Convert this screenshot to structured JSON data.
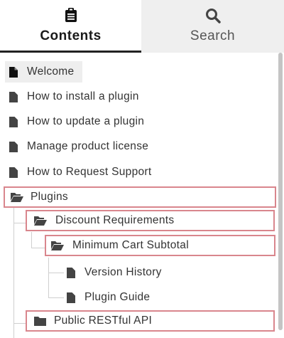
{
  "tabs": {
    "contents": {
      "label": "Contents",
      "icon": "clipboard-icon"
    },
    "search": {
      "label": "Search",
      "icon": "search-icon"
    }
  },
  "tree": {
    "welcome": "Welcome",
    "install": "How to install a plugin",
    "update": "How to update a plugin",
    "license": "Manage product license",
    "support": "How to Request Support",
    "plugins": "Plugins",
    "discount": "Discount Requirements",
    "min_cart": "Minimum Cart Subtotal",
    "version_history": "Version History",
    "plugin_guide": "Plugin Guide",
    "restful": "Public RESTful API"
  },
  "colors": {
    "highlight_border": "#d9868d",
    "active_tab_underline": "#222222"
  }
}
